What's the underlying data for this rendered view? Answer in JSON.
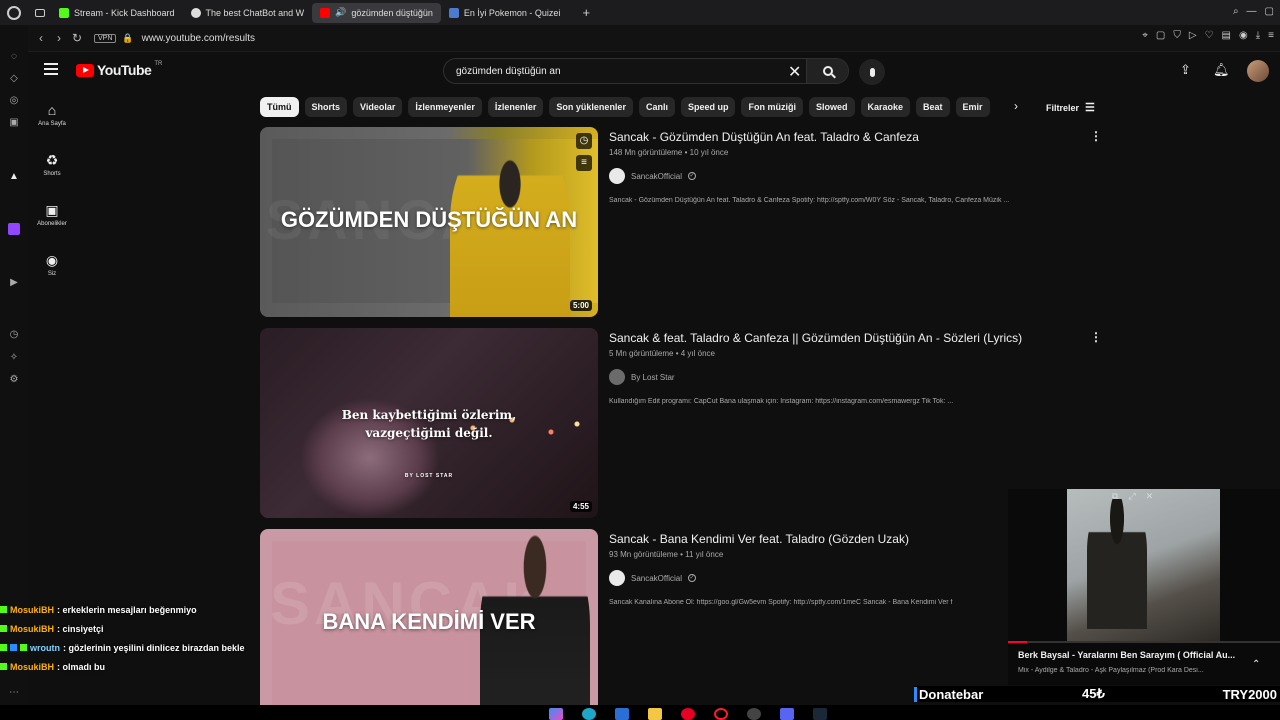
{
  "browser": {
    "tabs": [
      {
        "label": "Stream - Kick Dashboard",
        "icon": "kick-icon",
        "color": "#53fc18"
      },
      {
        "label": "The best ChatBot and W",
        "icon": "chatbot-icon",
        "color": "#dddddd"
      },
      {
        "label": "gözümden düştüğün",
        "icon": "youtube-icon",
        "color": "#ff0000",
        "active": true
      },
      {
        "label": "En İyi Pokemon - Quizei",
        "icon": "quiz-icon",
        "color": "#4a7bd1"
      }
    ],
    "vpn": "VPN",
    "url": "www.youtube.com/results"
  },
  "youtube": {
    "logo_text": "YouTube",
    "country": "TR",
    "search_value": "gözümden düştüğün an",
    "nav": [
      {
        "label": "Ana Sayfa",
        "icon": "home-icon",
        "glyph": "⌂"
      },
      {
        "label": "Shorts",
        "icon": "shorts-icon",
        "glyph": "♻"
      },
      {
        "label": "Abonelikler",
        "icon": "subscriptions-icon",
        "glyph": "▣"
      },
      {
        "label": "Siz",
        "icon": "you-icon",
        "glyph": "◉"
      }
    ],
    "chips": [
      "Tümü",
      "Shorts",
      "Videolar",
      "İzlenmeyenler",
      "İzlenenler",
      "Son yüklenenler",
      "Canlı",
      "Speed up",
      "Fon müziği",
      "Slowed",
      "Karaoke",
      "Beat",
      "Emir"
    ],
    "filters_label": "Filtreler",
    "results": [
      {
        "title": "Sancak - Gözümden Düştüğün An feat. Taladro & Canfeza",
        "meta": "148 Mn görüntüleme • 10 yıl önce",
        "channel": "SancakOfficial",
        "verified": true,
        "description": "Sancak - Gözümden Düştüğün An feat. Taladro & Canfeza Spotify: http://sptfy.com/W0Y Söz - Sancak, Taladro, Canfeza Müzik ...",
        "duration": "5:00",
        "thumb_text": "GÖZÜMDEN DÜŞTÜĞÜN AN",
        "thumb_ghost": "SANCAK"
      },
      {
        "title": "Sancak & feat. Taladro & Canfeza || Gözümden Düştüğün An - Sözleri (Lyrics)",
        "meta": "5 Mn görüntüleme • 4 yıl önce",
        "channel": "By Lost Star",
        "verified": false,
        "description": "Kullandığım Edit programı: CapCut Bana ulaşmak için: İnstagram: https://instagram.com/esmawergz Tik Tok: ...",
        "duration": "4:55",
        "thumb_text_1": "Ben kaybettiğimi özlerim,",
        "thumb_text_2": "vazgeçtiğimi değil.",
        "thumb_small": "BY LOST STAR"
      },
      {
        "title": "Sancak - Bana Kendimi Ver feat. Taladro (Gözden Uzak)",
        "meta": "93 Mn görüntüleme • 11 yıl önce",
        "channel": "SancakOfficial",
        "verified": true,
        "description": "Sancak Kanalına Abone Ol: https://goo.gl/Gw5evm Spotify: http://sptfy.com/1meC Sancak - Bana Kendimi Ver f",
        "thumb_text": "BANA KENDİMİ VER",
        "thumb_ghost": "SANCAK"
      }
    ],
    "miniplayer": {
      "title": "Berk Baysal - Yaralarını Ben Sarayım ( Official Au...",
      "subtitle": "Mix - Aydilge & Taladro - Aşk Paylaşılmaz (Prod Kara Desi...",
      "progress": 0.07
    }
  },
  "donatebar": {
    "brand": "Donatebar",
    "amount": "45₺",
    "goal": "TRY2000",
    "accent": "#2b8cff"
  },
  "chat": [
    {
      "user": "MosukiBH",
      "message": ": erkeklerin mesajları beğenmiyo"
    },
    {
      "user": "MosukiBH",
      "message": ": cinsiyetçi"
    },
    {
      "user": "wroutn",
      "message": ": gözlerinin yeşilini dinlicez birazdan bekle"
    },
    {
      "user": "MosukiBH",
      "message": ": olmadı bu"
    }
  ]
}
